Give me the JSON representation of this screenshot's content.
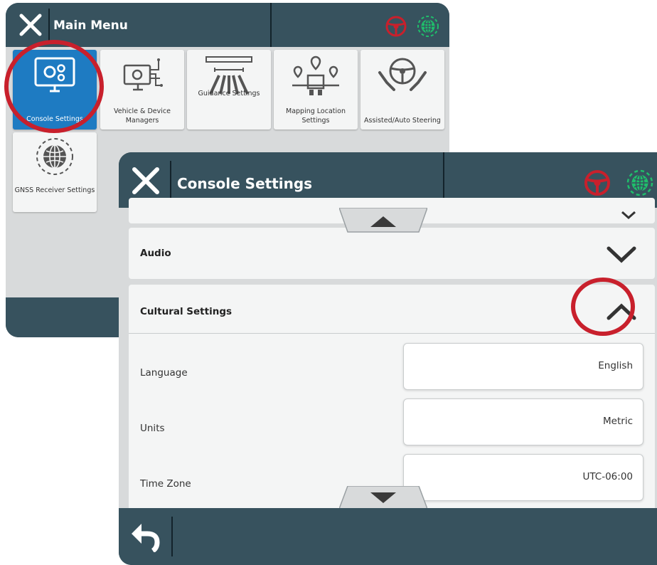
{
  "main_menu": {
    "title": "Main Menu",
    "tiles": [
      {
        "label": "Console Settings",
        "icon": "console-settings-icon",
        "selected": true
      },
      {
        "label": "Vehicle & Device Managers",
        "icon": "vehicle-device-icon"
      },
      {
        "label": "Guidance Settings",
        "icon": "guidance-icon"
      },
      {
        "label": "Mapping Location Settings",
        "icon": "mapping-location-icon"
      },
      {
        "label": "Assisted/Auto Steering",
        "icon": "steering-hands-icon"
      },
      {
        "label": "GNSS Receiver Settings",
        "icon": "gnss-globe-icon"
      }
    ]
  },
  "console_settings": {
    "title": "Console Settings",
    "sections": {
      "audio": {
        "label": "Audio",
        "expanded": false
      },
      "cultural": {
        "label": "Cultural Settings",
        "expanded": true
      }
    },
    "rows": [
      {
        "label": "Language",
        "value": "English"
      },
      {
        "label": "Units",
        "value": "Metric"
      },
      {
        "label": "Time Zone",
        "value": "UTC-06:00"
      }
    ]
  },
  "colors": {
    "header": "#37525e",
    "frame": "#1e2d36",
    "selected_tile": "#1e7bc2",
    "highlight_ring": "#c8202c",
    "steering_status": "#c8202c",
    "gnss_status": "#1fbf6b"
  }
}
